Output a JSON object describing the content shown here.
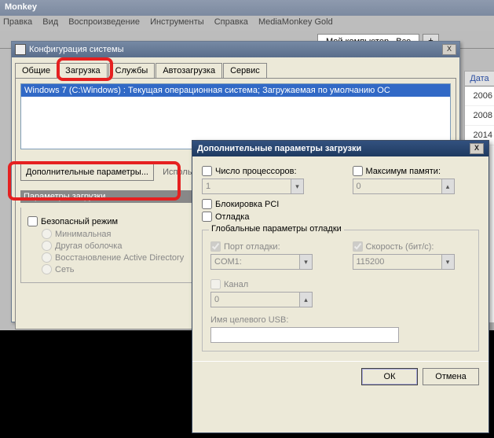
{
  "app": {
    "title": "Monkey",
    "menus": [
      "Правка",
      "Вид",
      "Воспроизведение",
      "Инструменты",
      "Справка",
      "MediaMonkey Gold"
    ],
    "main_tab": "Мой компьютер...Все",
    "plus": "+"
  },
  "date_col": {
    "header": "Дата",
    "rows": [
      "2006",
      "2008",
      "2014"
    ]
  },
  "msconfig": {
    "title": "Конфигурация системы",
    "tabs": [
      "Общие",
      "Загрузка",
      "Службы",
      "Автозагрузка",
      "Сервис"
    ],
    "os_entry": "Windows 7 (C:\\Windows) : Текущая операционная система; Загружаемая по умолчанию ОС",
    "advanced_button": "Дополнительные параметры...",
    "use_cut": "Исполь",
    "boot_params_banner": "Параметры загрузки",
    "safe_mode": "Безопасный режим",
    "radios": [
      "Минимальная",
      "Другая оболочка",
      "Восстановление Active Directory",
      "Сеть"
    ],
    "close_x": "X"
  },
  "adv": {
    "title": "Дополнительные параметры загрузки",
    "num_cpu": "Число процессоров:",
    "num_cpu_val": "1",
    "max_mem": "Максимум памяти:",
    "max_mem_val": "0",
    "pci_lock": "Блокировка PCI",
    "debug": "Отладка",
    "global_group": "Глобальные параметры отладки",
    "debug_port": "Порт отладки:",
    "debug_port_val": "COM1:",
    "baud": "Скорость (бит/с):",
    "baud_val": "115200",
    "channel": "Канал",
    "channel_val": "0",
    "usb_target": "Имя целевого USB:",
    "usb_target_val": "",
    "ok": "ОК",
    "cancel": "Отмена",
    "close_x": "X"
  }
}
